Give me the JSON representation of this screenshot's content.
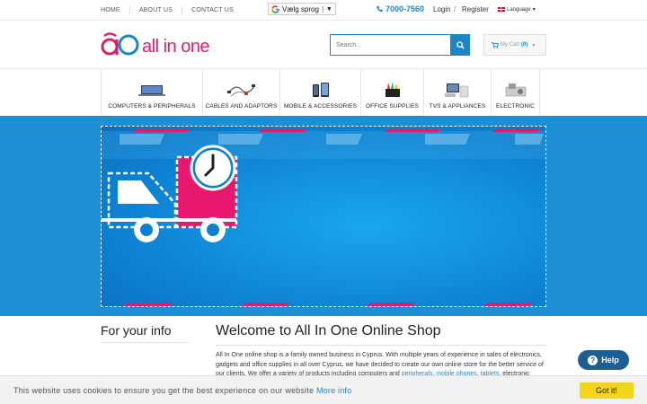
{
  "topnav": {
    "home": "HOME",
    "about": "ABOUT US",
    "contact": "CONTACT US"
  },
  "translate": {
    "label": "Vælg sprog",
    "caret": "▼"
  },
  "phone": "7000-7560",
  "account": {
    "login": "Login",
    "separator": "/",
    "register": "Register"
  },
  "language": {
    "label": "Language",
    "caret": "▾"
  },
  "logo": {
    "text": "all in one"
  },
  "search": {
    "placeholder": "Search..."
  },
  "cart": {
    "label": "My Cart",
    "count": "(0)",
    "caret": "▾"
  },
  "categories": [
    {
      "label": "COMPUTERS & PERIPHERALS"
    },
    {
      "label": "CABLES AND ADAPTORS"
    },
    {
      "label": "MOBILE & ACCESSORIES"
    },
    {
      "label": "OFFICE SUPPLIES"
    },
    {
      "label": "TVS & APPLIANCES"
    },
    {
      "label": "ELECTRONIC"
    }
  ],
  "sidebar": {
    "title": "For your info"
  },
  "main": {
    "title": "Welcome to All In One Online Shop",
    "intro_1": "All In One online shop is a family owned business in Cyprus. With multiple years of experience in sales of electronics, gadgets and office supplies in all over Cyprus, we have decided to create our own online store for the better service of our clients. We offer a variety of products including computers and ",
    "link_peripherals": "peripherals",
    "sep_1": ", ",
    "link_mobile": "mobile phones",
    "sep_2": ", ",
    "link_tablets": "tablets",
    "intro_2": ", electronic"
  },
  "help": {
    "label": "Help",
    "icon": "?"
  },
  "cookie": {
    "text": "This website uses cookies to ensure you get the best experience on our website ",
    "more": "More info",
    "button": "Got it!"
  },
  "colors": {
    "accent": "#1a86c6",
    "brand": "#d9206e",
    "banner": "#1e8fd2",
    "cookie_button": "#f4d51a",
    "help": "#1d5f93"
  },
  "icons": [
    "google-icon",
    "phone-icon",
    "flag-icon",
    "search-icon",
    "cart-icon",
    "truck-icon",
    "clock-icon",
    "help-icon"
  ]
}
